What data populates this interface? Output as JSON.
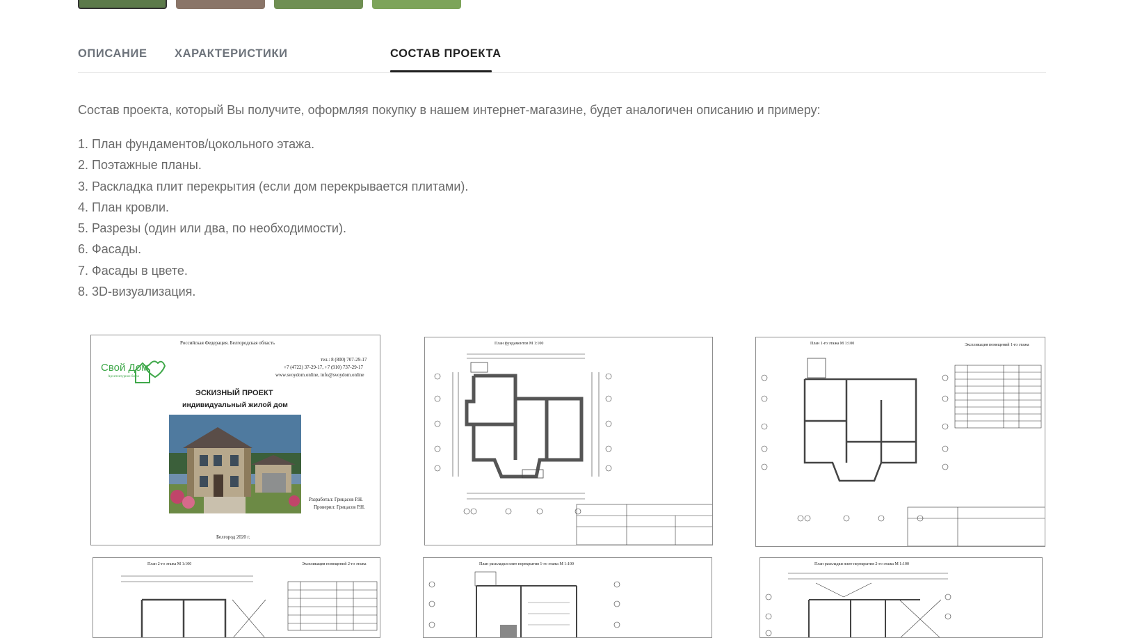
{
  "gallery": {
    "thumbnails": [
      {
        "alt": "thumb-1",
        "color": "#5c7a4a",
        "active": true
      },
      {
        "alt": "thumb-2",
        "color": "#8a7568"
      },
      {
        "alt": "thumb-3",
        "color": "#6f8f52"
      },
      {
        "alt": "thumb-4",
        "color": "#7da45a"
      }
    ]
  },
  "tabs": [
    {
      "label": "ОПИСАНИЕ"
    },
    {
      "label": "ХАРАКТЕРИСТИКИ"
    },
    {
      "label": "СОСТАВ ПРОЕКТА",
      "active": true
    }
  ],
  "content": {
    "intro": "Состав проекта, который Вы получите, оформляя покупку в нашем интернет-магазине, будет аналогичен описанию и примеру:",
    "items": [
      "1. План фундаментов/цокольного этажа.",
      "2. Поэтажные планы.",
      "3. Раскладка плит перекрытия (если дом перекрывается плитами).",
      "4. План кровли.",
      "5. Разрезы (один или два, по необходимости).",
      "6. Фасады.",
      "7. Фасады в цвете.",
      "8. 3D-визуализация."
    ]
  },
  "cover": {
    "region": "Российская Федерация. Белгородская область",
    "logo_text": "Свой Дом",
    "logo_sub": "Архитектурное бюро",
    "phones1": "тел.: 8 (800) 707-29-17",
    "phones2": "+7 (4722) 37-29-17, +7 (910) 737-29-17",
    "web": "www.svoydom.online, info@svoydom.online",
    "title1": "ЭСКИЗНЫЙ ПРОЕКТ",
    "title2": "индивидуальный жилой дом",
    "developer": "Разработал: Грицасов Р.Н.",
    "checker": "Проверил: Грицасов Р.Н.",
    "city": "Белгород 2020 г."
  },
  "drawings": {
    "foundation": "План фундаментов М 1:100",
    "floor1": "План 1-го этажа М 1:100",
    "floor1_table": "Экспликация помещений 1-го этажа",
    "floor2": "План 2-го этажа М 1:100",
    "floor2_table": "Экспликация помещений 2-го этажа",
    "slab1": "План раскладки плит перекрытия 1-го этажа М 1:100",
    "slab2": "План раскладки плит перекрытия 2-го этажа М 1:100",
    "stamp_title": "Индивидуальный жилой дом"
  },
  "colors": {
    "accent": "#222222",
    "text": "#6a6a6a",
    "tab_inactive": "#6d737b",
    "sheet_border": "#8d8d8d"
  }
}
